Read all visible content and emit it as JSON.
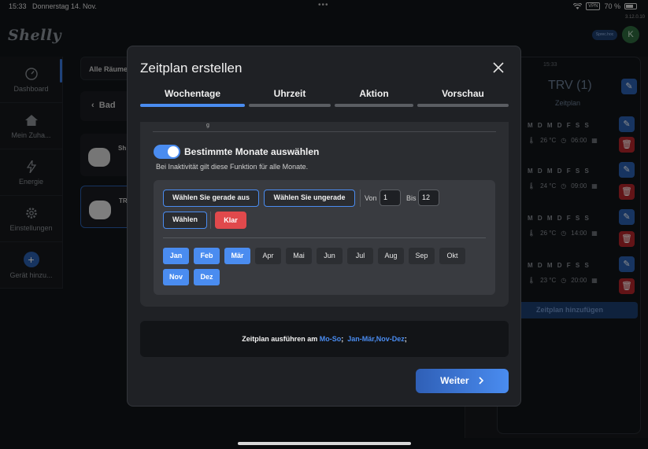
{
  "statusbar": {
    "time": "15:33",
    "date": "Donnerstag 14. Nov.",
    "vpn": "VPN",
    "battery": "70 %",
    "version": "3.12.0.10"
  },
  "app": {
    "logo": "Shelly",
    "pill": "Sprec.hoc",
    "avatar": "K"
  },
  "sidebar": {
    "items": [
      {
        "label": "Dashboard",
        "icon": "dashboard-icon"
      },
      {
        "label": "Mein Zuha...",
        "icon": "home-icon"
      },
      {
        "label": "Energie",
        "icon": "energy-icon"
      },
      {
        "label": "Einstellungen",
        "icon": "gear-icon"
      },
      {
        "label": "Gerät hinzu...",
        "icon": "plus-icon"
      }
    ]
  },
  "rooms": {
    "tab": "Alle Räume",
    "room": "Bad",
    "devices": [
      "Sh",
      "TR"
    ]
  },
  "right_panel": {
    "title": "TRV (1)",
    "subtitle": "Zeitplan",
    "top_time": "15:33",
    "schedules": [
      {
        "days": "M D M D F S S",
        "temp": "26 °C",
        "time": "06:00"
      },
      {
        "days": "M D M D F S S",
        "temp": "24 °C",
        "time": "09:00"
      },
      {
        "days": "M D M D F S S",
        "temp": "26 °C",
        "time": "14:00"
      },
      {
        "days": "M D M D F S S",
        "temp": "23 °C",
        "time": "20:00"
      }
    ],
    "add_label": "Zeitplan hinzufügen"
  },
  "modal": {
    "title": "Zeitplan erstellen",
    "close": "✕",
    "tabs": [
      {
        "label": "Wochentage",
        "active": true
      },
      {
        "label": "Uhrzeit",
        "active": false
      },
      {
        "label": "Aktion",
        "active": false
      },
      {
        "label": "Vorschau",
        "active": false
      }
    ],
    "cut_text": "g",
    "toggle_label": "Bestimmte Monate auswählen",
    "toggle_hint": "Bei Inaktivität gilt diese Funktion für alle Monate.",
    "toggle_on": true,
    "buttons": {
      "even": "Wählen Sie gerade aus",
      "odd": "Wählen Sie ungerade",
      "select": "Wählen",
      "clear": "Klar"
    },
    "range": {
      "from_label": "Von",
      "from_value": "1",
      "to_label": "Bis",
      "to_value": "12"
    },
    "months": [
      {
        "label": "Jan",
        "selected": true
      },
      {
        "label": "Feb",
        "selected": true
      },
      {
        "label": "Mär",
        "selected": true
      },
      {
        "label": "Apr",
        "selected": false
      },
      {
        "label": "Mai",
        "selected": false
      },
      {
        "label": "Jun",
        "selected": false
      },
      {
        "label": "Jul",
        "selected": false
      },
      {
        "label": "Aug",
        "selected": false
      },
      {
        "label": "Sep",
        "selected": false
      },
      {
        "label": "Okt",
        "selected": false
      },
      {
        "label": "Nov",
        "selected": true
      },
      {
        "label": "Dez",
        "selected": true
      }
    ],
    "summary": {
      "prefix": "Zeitplan ausführen am",
      "days": "Mo-So",
      "sep": ";",
      "months": "Jan-Mär,Nov-Dez",
      "end": ";"
    },
    "next": "Weiter"
  },
  "colors": {
    "accent": "#4a8cf0",
    "danger": "#e0494c",
    "modal_bg": "#1f2125"
  }
}
